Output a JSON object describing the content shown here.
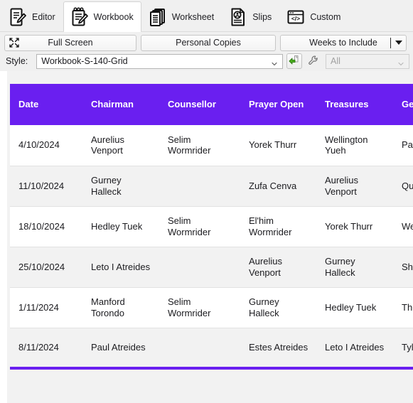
{
  "tabs": [
    {
      "label": "Editor",
      "icon": "document-pencil-icon",
      "active": false
    },
    {
      "label": "Workbook",
      "icon": "notepad-pencil-icon",
      "active": true
    },
    {
      "label": "Worksheet",
      "icon": "stacked-pages-icon",
      "active": false
    },
    {
      "label": "Slips",
      "icon": "person-document-icon",
      "active": false
    },
    {
      "label": "Custom",
      "icon": "code-window-icon",
      "active": false
    }
  ],
  "toolbar": {
    "fullscreen_label": "Full Screen",
    "fullscreen_icon": "expand-arrows-icon",
    "personal_copies_label": "Personal Copies",
    "weeks_label": "Weeks to Include",
    "weeks_caret_icon": "caret-down-icon"
  },
  "style_row": {
    "label": "Style:",
    "value": "Workbook-S-140-Grid",
    "chevron_icon": "chevron-down-icon",
    "import_icon": "import-green-arrow-icon",
    "settings_icon": "wrench-icon",
    "filter_value": "All",
    "filter_chevron_icon": "chevron-down-icon"
  },
  "table": {
    "accent_color": "#6a1ff0",
    "header_text_color": "#ffffff",
    "columns": [
      "Date",
      "Chairman",
      "Counsellor",
      "Prayer Open",
      "Treasures",
      "Gems"
    ],
    "rows": [
      {
        "date": "4/10/2024",
        "chairman": "Aurelius Venport",
        "counsellor": "Selim Wormrider",
        "prayer_open": "Yorek Thurr",
        "treasures": "Wellington Yueh",
        "gems": "Paul Atreides"
      },
      {
        "date": "11/10/2024",
        "chairman": "Gurney Halleck",
        "counsellor": "",
        "prayer_open": "Zufa Cenva",
        "treasures": "Aurelius Venport",
        "gems": "Quentin (Vigar)"
      },
      {
        "date": "18/10/2024",
        "chairman": "Hedley Tuek",
        "counsellor": "Selim Wormrider",
        "prayer_open": "El'him Wormrider",
        "treasures": "Yorek Thurr",
        "gems": "Wellington Yueh"
      },
      {
        "date": "25/10/2024",
        "chairman": "Leto I Atreides",
        "counsellor": "",
        "prayer_open": "Aurelius Venport",
        "treasures": "Gurney Halleck",
        "gems": "Shaddam Manor"
      },
      {
        "date": "1/11/2024",
        "chairman": "Manford Torondo",
        "counsellor": "Selim Wormrider",
        "prayer_open": "Gurney Halleck",
        "treasures": "Hedley Tuek",
        "gems": "Thufir Hawat"
      },
      {
        "date": "8/11/2024",
        "chairman": "Paul Atreides",
        "counsellor": "",
        "prayer_open": "Estes Atreides",
        "treasures": "Leto I Atreides",
        "gems": "Tylwyth Waff"
      }
    ]
  }
}
